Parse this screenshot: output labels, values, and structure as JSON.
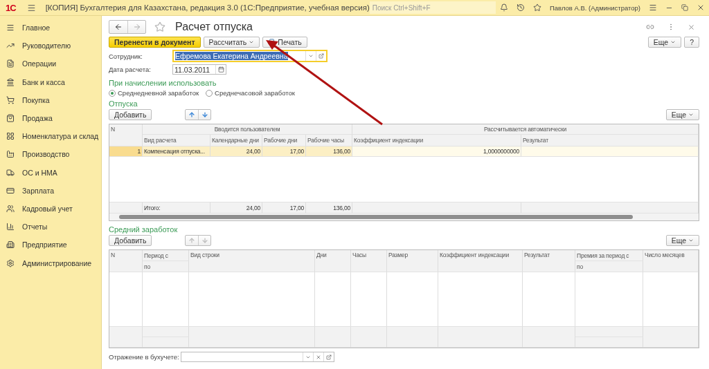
{
  "app": {
    "logo": "1С",
    "title": "[КОПИЯ] Бухгалтерия для Казахстана, редакция 3.0  (1С:Предприятие, учебная версия)",
    "search": {
      "placeholder": "Поиск Ctrl+Shift+F"
    },
    "user": "Павлов А.В. (Администратор)"
  },
  "sidebar": {
    "items": [
      {
        "label": "Главное"
      },
      {
        "label": "Руководителю"
      },
      {
        "label": "Операции"
      },
      {
        "label": "Банк и касса"
      },
      {
        "label": "Покупка"
      },
      {
        "label": "Продажа"
      },
      {
        "label": "Номенклатура и склад"
      },
      {
        "label": "Производство"
      },
      {
        "label": "ОС и НМА"
      },
      {
        "label": "Зарплата"
      },
      {
        "label": "Кадровый учет"
      },
      {
        "label": "Отчеты"
      },
      {
        "label": "Предприятие"
      },
      {
        "label": "Администрирование"
      }
    ]
  },
  "form": {
    "title": "Расчет отпуска",
    "more": "Еще",
    "help": "?",
    "toolbar": [
      {
        "label": "Перенести в документ",
        "kind": "primary"
      },
      {
        "label": "Рассчитать",
        "kind": "dropdown"
      },
      {
        "label": "Печать",
        "kind": "print"
      }
    ],
    "employee": {
      "label": "Сотрудник:",
      "value": "Ефремова Екатерина Андреевна",
      "focused": true
    },
    "date": {
      "label": "Дата расчета:",
      "value": "11.03.2011"
    },
    "basis": {
      "title": "При начислении использовать",
      "options": [
        {
          "label": "Среднедневной заработок",
          "selected": true
        },
        {
          "label": "Среднечасовой заработок",
          "selected": false
        }
      ]
    },
    "vacations": {
      "title": "Отпуска",
      "add": "Добавить",
      "more": "Еще",
      "move_disabled": false,
      "number_header": "N",
      "groups": [
        {
          "label": "Вводится пользователем",
          "columns": [
            "Вид расчета",
            "Календарные дни",
            "Рабочие дни",
            "Рабочие часы"
          ]
        },
        {
          "label": "Рассчитывается автоматически",
          "columns": [
            "Коэффициент индексации",
            "Результат"
          ]
        }
      ],
      "rows": [
        {
          "cells": [
            "1",
            "Компенсация отпуска...",
            "24,00",
            "17,00",
            "136,00",
            "1,0000000000"
          ],
          "selected": true
        }
      ],
      "totals": {
        "label": "Итого:",
        "values": [
          "24,00",
          "17,00",
          "136,00"
        ]
      }
    },
    "average": {
      "title": "Средний заработок",
      "add": "Добавить",
      "more": "Еще",
      "move_disabled": true,
      "columns": [
        {
          "label": "N"
        },
        {
          "label": "Период с",
          "sub": "по"
        },
        {
          "label": "Вид строки"
        },
        {
          "label": "Дни"
        },
        {
          "label": "Часы"
        },
        {
          "label": "Размер"
        },
        {
          "label": "Коэффициент индексации"
        },
        {
          "label": "Результат"
        },
        {
          "label": "Премия за период с",
          "sub": "по"
        },
        {
          "label": "Число месяцев"
        }
      ]
    },
    "posting": {
      "label": "Отражение в бухучете:"
    }
  }
}
